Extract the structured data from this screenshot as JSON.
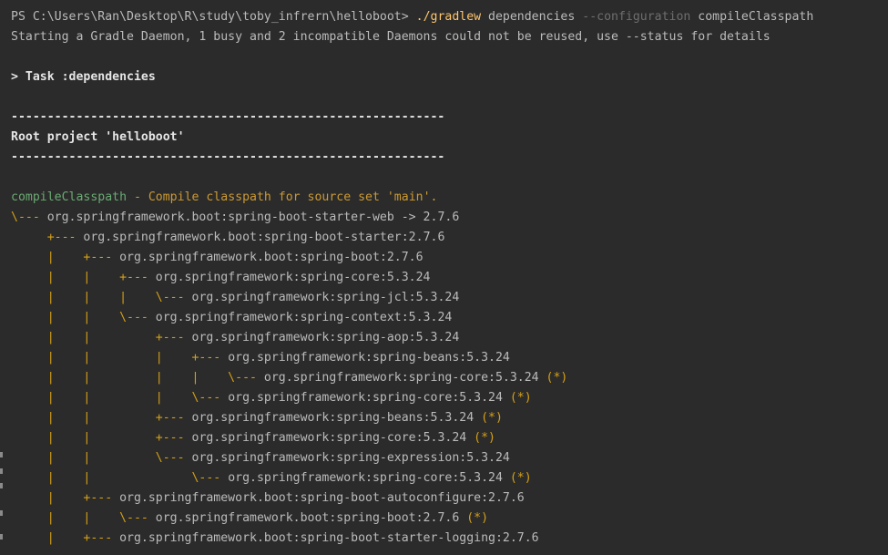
{
  "prompt": {
    "path": "PS C:\\Users\\Ran\\Desktop\\R\\study\\toby_infrern\\helloboot> ",
    "command": "./gradlew",
    "arg1": " dependencies ",
    "flag": "--configuration",
    "arg2": " compileClasspath"
  },
  "daemon_message": "Starting a Gradle Daemon, 1 busy and 2 incompatible Daemons could not be reused, use --status for details",
  "task_line": "> Task :dependencies",
  "separator": "------------------------------------------------------------",
  "project_title": "Root project 'helloboot'",
  "config": {
    "name": "compileClasspath",
    "description": " - Compile classpath for source set 'main'."
  },
  "tree": [
    {
      "prefix": "\\--- ",
      "text": "org.springframework.boot:spring-boot-starter-web -> 2.7.6",
      "mark": ""
    },
    {
      "prefix": "     +--- ",
      "text": "org.springframework.boot:spring-boot-starter:2.7.6",
      "mark": ""
    },
    {
      "prefix": "     |    +--- ",
      "text": "org.springframework.boot:spring-boot:2.7.6",
      "mark": ""
    },
    {
      "prefix": "     |    |    +--- ",
      "text": "org.springframework:spring-core:5.3.24",
      "mark": ""
    },
    {
      "prefix": "     |    |    |    \\--- ",
      "text": "org.springframework:spring-jcl:5.3.24",
      "mark": ""
    },
    {
      "prefix": "     |    |    \\--- ",
      "text": "org.springframework:spring-context:5.3.24",
      "mark": ""
    },
    {
      "prefix": "     |    |         +--- ",
      "text": "org.springframework:spring-aop:5.3.24",
      "mark": ""
    },
    {
      "prefix": "     |    |         |    +--- ",
      "text": "org.springframework:spring-beans:5.3.24",
      "mark": ""
    },
    {
      "prefix": "     |    |         |    |    \\--- ",
      "text": "org.springframework:spring-core:5.3.24",
      "mark": " (*)"
    },
    {
      "prefix": "     |    |         |    \\--- ",
      "text": "org.springframework:spring-core:5.3.24",
      "mark": " (*)"
    },
    {
      "prefix": "     |    |         +--- ",
      "text": "org.springframework:spring-beans:5.3.24",
      "mark": " (*)"
    },
    {
      "prefix": "     |    |         +--- ",
      "text": "org.springframework:spring-core:5.3.24",
      "mark": " (*)"
    },
    {
      "prefix": "     |    |         \\--- ",
      "text": "org.springframework:spring-expression:5.3.24",
      "mark": ""
    },
    {
      "prefix": "     |    |              \\--- ",
      "text": "org.springframework:spring-core:5.3.24",
      "mark": " (*)"
    },
    {
      "prefix": "     |    +--- ",
      "text": "org.springframework.boot:spring-boot-autoconfigure:2.7.6",
      "mark": ""
    },
    {
      "prefix": "     |    |    \\--- ",
      "text": "org.springframework.boot:spring-boot:2.7.6",
      "mark": " (*)"
    },
    {
      "prefix": "     |    +--- ",
      "text": "org.springframework.boot:spring-boot-starter-logging:2.7.6",
      "mark": ""
    }
  ]
}
